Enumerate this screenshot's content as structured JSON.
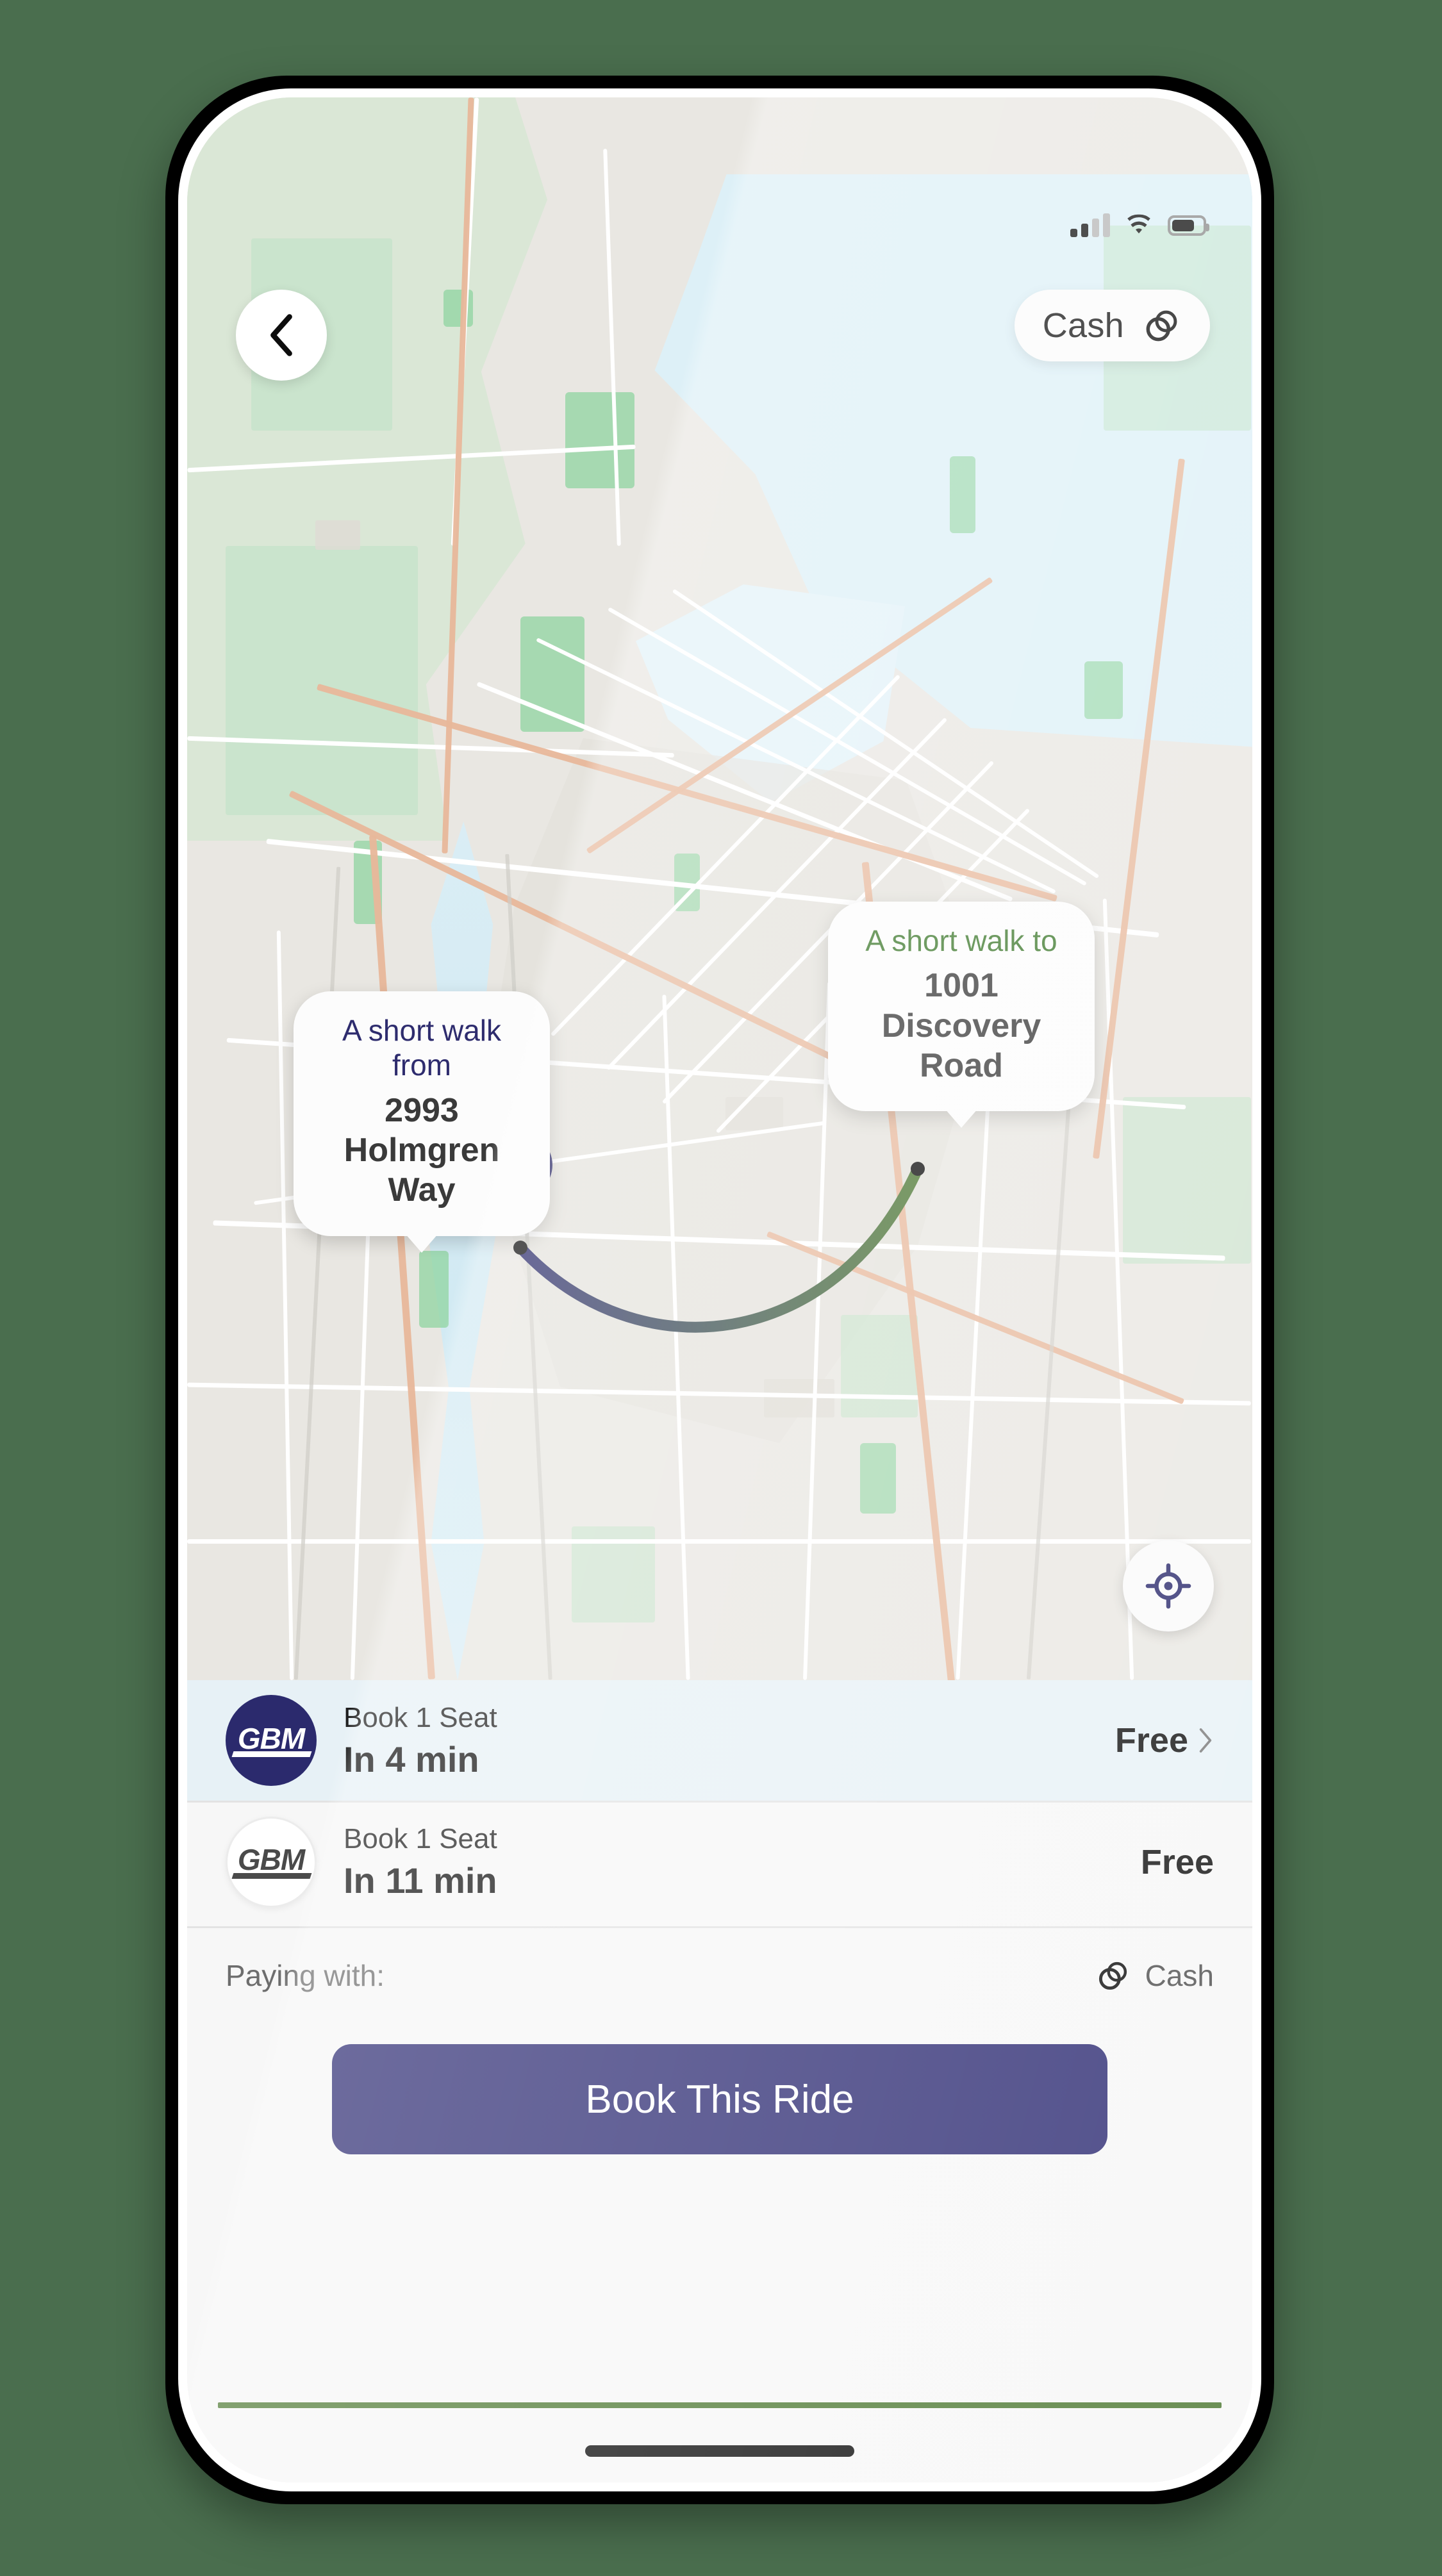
{
  "background_color": "#4a6e4e",
  "status_bar": {
    "signal_icon": "cellular-signal-icon",
    "signal_bars_active": 2,
    "signal_bars_total": 4,
    "wifi_icon": "wifi-icon",
    "battery_icon": "battery-icon",
    "battery_level_percent": 66
  },
  "map": {
    "back_button": {
      "icon": "chevron-left-icon",
      "label": ""
    },
    "payment_pill": {
      "label": "Cash",
      "icon": "cash-coins-icon"
    },
    "locate_button": {
      "icon": "crosshair-locate-icon"
    },
    "origin_callout": {
      "kicker": "A short walk from",
      "address": "2993 Holmgren Way",
      "kicker_color": "#2e2c6e"
    },
    "destination_callout": {
      "kicker": "A short walk to",
      "address": "1001 Discovery Road",
      "kicker_color": "#3f7a2e"
    },
    "origin_pin_color": "#2b2a6d",
    "destination_pin_color": "#4f7a34",
    "route_color_start": "#2b2a6d",
    "route_color_end": "#4f7a34"
  },
  "sheet": {
    "rides": [
      {
        "logo_text": "GBM",
        "logo_style": "filled",
        "seats_label": "Book 1 Seat",
        "eta_label": "In 4 min",
        "price_label": "Free",
        "chevron_icon": "chevron-right-icon",
        "selected": true
      },
      {
        "logo_text": "GBM",
        "logo_style": "outline",
        "seats_label": "Book 1 Seat",
        "eta_label": "In 11 min",
        "price_label": "Free",
        "chevron_icon": "",
        "selected": false
      }
    ],
    "paying_with_label": "Paying with:",
    "paying_with_value": "Cash",
    "paying_with_icon": "cash-coins-icon",
    "cta_label": "Book This Ride",
    "cta_color": "#2f2d74",
    "rule_color": "#4f7a34"
  }
}
